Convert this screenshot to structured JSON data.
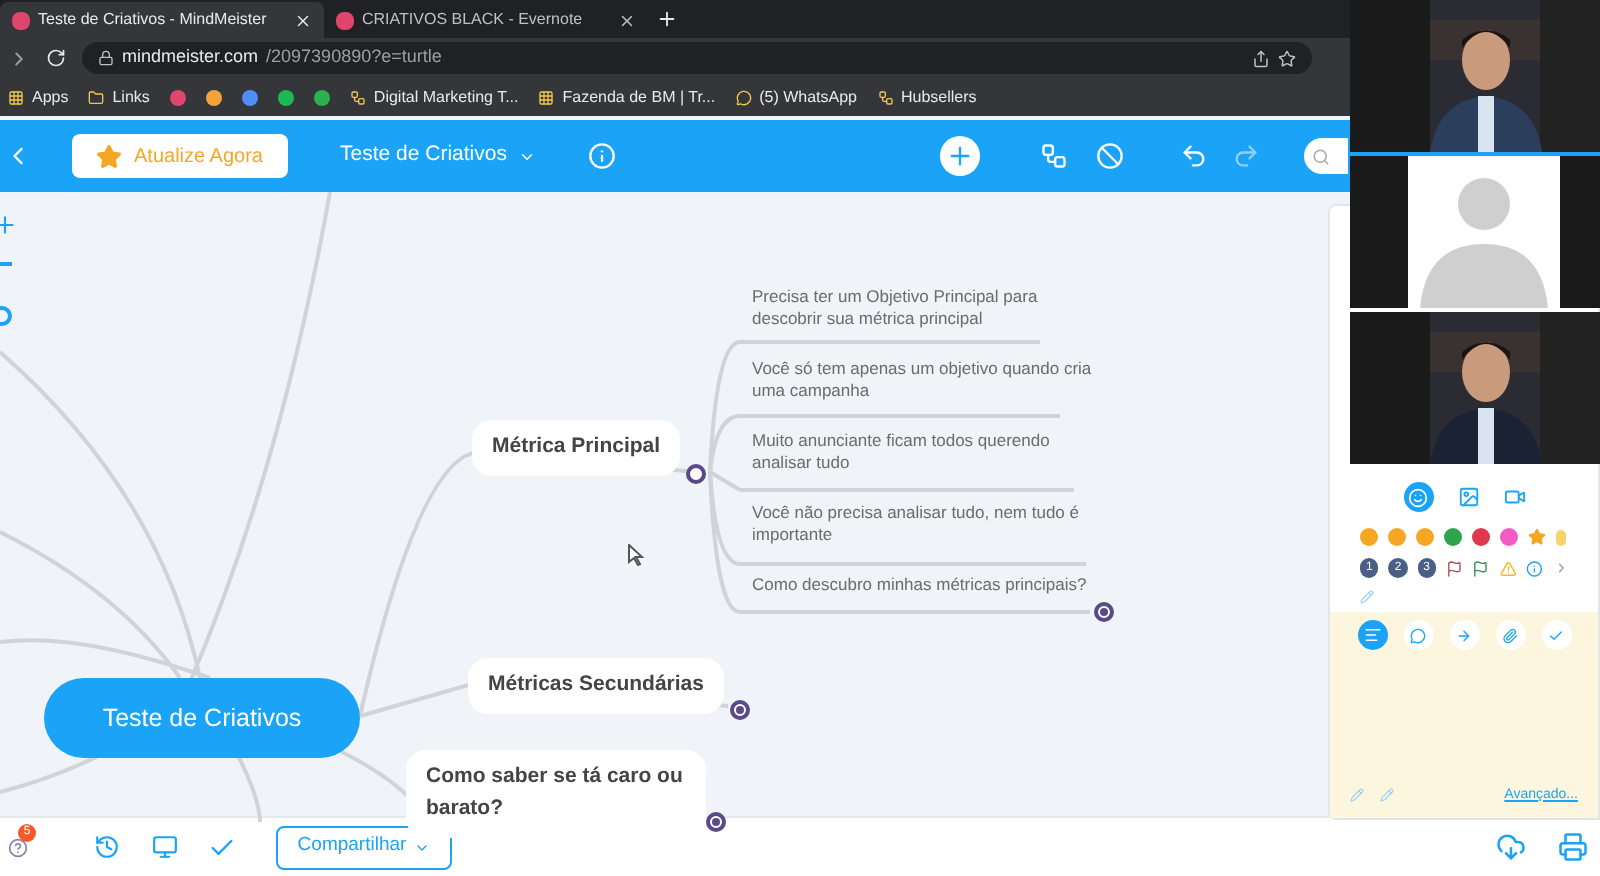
{
  "browser": {
    "tabs": [
      {
        "title": "Teste de Criativos - MindMeister",
        "selected": true
      },
      {
        "title": "CRIATIVOS BLACK - Evernote",
        "selected": false
      }
    ],
    "url_host": "mindmeister.com",
    "url_path": "/2097390890?e=turtle",
    "bookmarks": [
      {
        "label": "Apps",
        "kind": "apps"
      },
      {
        "label": "Links",
        "kind": "folder"
      },
      {
        "label": "Digital Marketing T...",
        "kind": "site"
      },
      {
        "label": "Fazenda de BM | Tr...",
        "kind": "board"
      },
      {
        "label": "(5) WhatsApp",
        "kind": "chat"
      },
      {
        "label": "Hubsellers",
        "kind": "site"
      }
    ]
  },
  "toolbar": {
    "upgrade_button": "Atualize Agora",
    "map_title": "Teste de Criativos"
  },
  "mindmap": {
    "root": "Teste de Criativos",
    "topics": [
      {
        "label": "Métrica Principal",
        "children": [
          {
            "label": "Precisa ter um Objetivo Principal para descobrir sua métrica principal"
          },
          {
            "label": "Você só tem apenas um objetivo quando cria uma campanha"
          },
          {
            "label": "Muito anunciante ficam todos querendo analisar tudo"
          },
          {
            "label": "Você não precisa analisar tudo, nem tudo é importante"
          },
          {
            "label": "Como descubro minhas métricas principais?"
          }
        ]
      },
      {
        "label": "Métricas Secundárias"
      },
      {
        "label": "Como saber se tá caro ou barato?"
      }
    ]
  },
  "panel": {
    "priority_icons": [
      "1",
      "2",
      "3"
    ],
    "advanced_link": "Avançado..."
  },
  "bottom_bar": {
    "notification_count": "5",
    "share_button": "Compartilhar"
  },
  "video_tiles": [
    {
      "kind": "picture"
    },
    {
      "kind": "avatar"
    },
    {
      "kind": "picture"
    }
  ]
}
